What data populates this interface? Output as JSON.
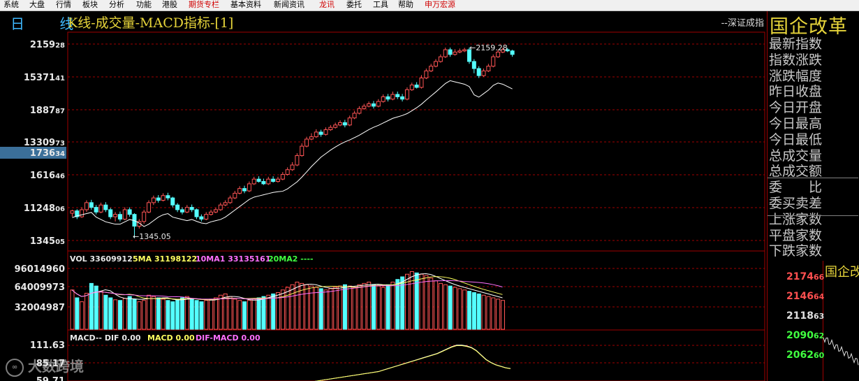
{
  "menu": [
    "系统",
    "大盘",
    "行情",
    "板块",
    "分析",
    "功能",
    "港股",
    "期货专栏",
    "基本资料",
    "新闻资讯",
    "龙讯",
    "委托",
    "工具",
    "帮助",
    "申万宏源"
  ],
  "menu_red": [
    7,
    10,
    14
  ],
  "title": {
    "period": "日 线",
    "main": "K线-成交量-MACD指标-[1]",
    "index_name": "--深证成指"
  },
  "right_panel": {
    "title": "国企改革",
    "rows": [
      "最新指数",
      "指数涨跌",
      "涨跌幅度",
      "昨日收盘",
      "今日开盘",
      "今日最高",
      "今日最低",
      "总成交量",
      "总成交额",
      "委　　比",
      "委买卖差",
      "上涨家数",
      "平盘家数",
      "下跌家数"
    ],
    "mini_title": "国企改",
    "mini_prices": [
      {
        "text": "2174",
        "sub": "66",
        "color": "#ff5050"
      },
      {
        "text": "2146",
        "sub": "64",
        "color": "#ff5050"
      },
      {
        "text": "2118",
        "sub": "63",
        "color": "#e0e0e0"
      },
      {
        "text": "2090",
        "sub": "62",
        "color": "#40ff40"
      },
      {
        "text": "2062",
        "sub": "60",
        "color": "#40ff40"
      }
    ]
  },
  "axis": {
    "price_labels": [
      {
        "big": "2159",
        "small": "28"
      },
      {
        "big": "15371",
        "small": "41"
      },
      {
        "big": "1887",
        "small": "87"
      },
      {
        "big": "13309",
        "small": "73"
      },
      {
        "big": "1736",
        "small": "34"
      },
      {
        "big": "1616",
        "small": "46"
      },
      {
        "big": "11248",
        "small": "06"
      },
      {
        "big": "1345",
        "small": "05"
      }
    ],
    "vol_labels": [
      "96014960",
      "64009973",
      "32004987"
    ],
    "macd_labels": [
      "111.63",
      "85.17",
      "59.71"
    ]
  },
  "indicators": {
    "vol": "VOL 33609912",
    "ma5": "5MA 31198122",
    "ma10": "10MA1 33135161",
    "ma20": "20MA2 ----",
    "macd": "MACD-- DIF 0.00",
    "macd_val": "MACD 0.00",
    "dif_macd": "DIF-MACD 0.00"
  },
  "annotations": {
    "high": "2159.28",
    "low": "1345.05"
  },
  "watermark": "大数跨境",
  "colors": {
    "up": "#ff5555",
    "down": "#54ffff",
    "grid": "#a00000",
    "ma5": "#ffffff",
    "ma10": "#ffff60",
    "ma20": "#ff70ff"
  },
  "chart_data": {
    "type": "candlestick",
    "price_range": [
      1345.05,
      2159.28
    ],
    "candles": [
      [
        1455,
        1465,
        1470,
        1440
      ],
      [
        1465,
        1440,
        1472,
        1430
      ],
      [
        1440,
        1470,
        1480,
        1435
      ],
      [
        1470,
        1500,
        1510,
        1460
      ],
      [
        1500,
        1480,
        1512,
        1470
      ],
      [
        1480,
        1460,
        1490,
        1450
      ],
      [
        1460,
        1490,
        1500,
        1455
      ],
      [
        1490,
        1470,
        1502,
        1460
      ],
      [
        1470,
        1440,
        1478,
        1430
      ],
      [
        1440,
        1450,
        1460,
        1420
      ],
      [
        1450,
        1430,
        1462,
        1420
      ],
      [
        1430,
        1470,
        1480,
        1425
      ],
      [
        1470,
        1450,
        1480,
        1440
      ],
      [
        1450,
        1400,
        1455,
        1350
      ],
      [
        1400,
        1420,
        1430,
        1390
      ],
      [
        1420,
        1460,
        1470,
        1410
      ],
      [
        1460,
        1500,
        1510,
        1455
      ],
      [
        1500,
        1520,
        1530,
        1490
      ],
      [
        1520,
        1510,
        1532,
        1500
      ],
      [
        1510,
        1530,
        1540,
        1505
      ],
      [
        1530,
        1520,
        1542,
        1510
      ],
      [
        1520,
        1490,
        1525,
        1480
      ],
      [
        1490,
        1470,
        1498,
        1460
      ],
      [
        1470,
        1460,
        1480,
        1450
      ],
      [
        1460,
        1480,
        1490,
        1455
      ],
      [
        1480,
        1470,
        1492,
        1460
      ],
      [
        1470,
        1440,
        1475,
        1430
      ],
      [
        1440,
        1430,
        1450,
        1420
      ],
      [
        1430,
        1450,
        1460,
        1425
      ],
      [
        1450,
        1460,
        1470,
        1445
      ],
      [
        1460,
        1470,
        1478,
        1455
      ],
      [
        1470,
        1490,
        1500,
        1465
      ],
      [
        1490,
        1500,
        1510,
        1485
      ],
      [
        1500,
        1520,
        1530,
        1495
      ],
      [
        1520,
        1540,
        1550,
        1515
      ],
      [
        1540,
        1560,
        1570,
        1535
      ],
      [
        1560,
        1550,
        1572,
        1540
      ],
      [
        1550,
        1580,
        1590,
        1545
      ],
      [
        1580,
        1600,
        1610,
        1575
      ],
      [
        1600,
        1590,
        1612,
        1585
      ],
      [
        1590,
        1580,
        1602,
        1575
      ],
      [
        1580,
        1600,
        1610,
        1575
      ],
      [
        1600,
        1590,
        1612,
        1585
      ],
      [
        1590,
        1600,
        1610,
        1585
      ],
      [
        1600,
        1620,
        1630,
        1595
      ],
      [
        1620,
        1640,
        1650,
        1615
      ],
      [
        1640,
        1660,
        1672,
        1635
      ],
      [
        1660,
        1700,
        1710,
        1655
      ],
      [
        1700,
        1740,
        1752,
        1695
      ],
      [
        1740,
        1770,
        1780,
        1735
      ],
      [
        1770,
        1780,
        1795,
        1765
      ],
      [
        1780,
        1800,
        1812,
        1775
      ],
      [
        1800,
        1790,
        1810,
        1780
      ],
      [
        1790,
        1810,
        1820,
        1785
      ],
      [
        1810,
        1820,
        1830,
        1805
      ],
      [
        1820,
        1830,
        1840,
        1815
      ],
      [
        1830,
        1840,
        1850,
        1825
      ],
      [
        1840,
        1830,
        1852,
        1820
      ],
      [
        1830,
        1860,
        1870,
        1825
      ],
      [
        1860,
        1880,
        1890,
        1855
      ],
      [
        1880,
        1900,
        1910,
        1875
      ],
      [
        1900,
        1910,
        1920,
        1895
      ],
      [
        1910,
        1920,
        1930,
        1905
      ],
      [
        1920,
        1910,
        1932,
        1900
      ],
      [
        1910,
        1930,
        1940,
        1905
      ],
      [
        1930,
        1950,
        1960,
        1925
      ],
      [
        1950,
        1940,
        1962,
        1930
      ],
      [
        1940,
        1960,
        1972,
        1935
      ],
      [
        1960,
        1950,
        1972,
        1940
      ],
      [
        1950,
        1940,
        1962,
        1930
      ],
      [
        1940,
        1980,
        1990,
        1935
      ],
      [
        1980,
        2000,
        2010,
        1975
      ],
      [
        2000,
        1990,
        2012,
        1985
      ],
      [
        1990,
        2030,
        2042,
        1985
      ],
      [
        2030,
        2060,
        2070,
        2025
      ],
      [
        2060,
        2080,
        2090,
        2055
      ],
      [
        2080,
        2100,
        2110,
        2075
      ],
      [
        2100,
        2120,
        2130,
        2095
      ],
      [
        2120,
        2150,
        2159,
        2115
      ],
      [
        2150,
        2130,
        2159,
        2120
      ],
      [
        2130,
        2140,
        2152,
        2125
      ],
      [
        2140,
        2145,
        2155,
        2135
      ],
      [
        2145,
        2150,
        2158,
        2140
      ],
      [
        2150,
        2100,
        2159,
        2090
      ],
      [
        2100,
        2070,
        2110,
        2050
      ],
      [
        2070,
        2040,
        2080,
        2030
      ],
      [
        2040,
        2060,
        2070,
        2035
      ],
      [
        2060,
        2080,
        2090,
        2055
      ],
      [
        2080,
        2120,
        2130,
        2075
      ],
      [
        2120,
        2140,
        2150,
        2115
      ],
      [
        2140,
        2150,
        2159,
        2135
      ],
      [
        2150,
        2145,
        2158,
        2140
      ],
      [
        2145,
        2130,
        2150,
        2120
      ]
    ],
    "ma_line": [
      1478,
      1485,
      1490,
      1495,
      1500,
      1480,
      1470,
      1460,
      1455,
      1450,
      1450,
      1460,
      1470,
      1465,
      1455,
      1440,
      1450,
      1465,
      1480,
      1490,
      1495,
      1480,
      1475,
      1470,
      1465,
      1470,
      1462,
      1455,
      1452,
      1460,
      1465,
      1470,
      1480,
      1495,
      1510,
      1525,
      1540,
      1555,
      1565,
      1570,
      1575,
      1580,
      1585,
      1588,
      1590,
      1600,
      1615,
      1630,
      1650,
      1672,
      1695,
      1715,
      1735,
      1750,
      1765,
      1778,
      1790,
      1800,
      1808,
      1818,
      1828,
      1840,
      1852,
      1862,
      1870,
      1880,
      1890,
      1900,
      1906,
      1912,
      1920,
      1932,
      1945,
      1960,
      1978,
      1995,
      2012,
      2030,
      2048,
      2060,
      2055,
      2050,
      2045,
      2035,
      2000,
      1990,
      2005,
      2020,
      2040,
      2050,
      2045,
      2035,
      2025
    ],
    "volume": [
      60,
      48,
      42,
      55,
      70,
      66,
      58,
      52,
      48,
      45,
      44,
      47,
      50,
      46,
      42,
      44,
      52,
      50,
      48,
      46,
      44,
      42,
      45,
      48,
      50,
      46,
      44,
      42,
      44,
      46,
      48,
      52,
      54,
      50,
      46,
      44,
      42,
      44,
      46,
      48,
      50,
      52,
      54,
      56,
      60,
      64,
      68,
      72,
      70,
      68,
      66,
      64,
      62,
      60,
      62,
      64,
      66,
      68,
      66,
      64,
      68,
      70,
      72,
      68,
      66,
      64,
      68,
      72,
      76,
      80,
      84,
      88,
      86,
      84,
      82,
      78,
      74,
      70,
      68,
      66,
      64,
      62,
      60,
      58,
      56,
      54,
      52,
      50,
      48,
      46,
      44
    ],
    "volume_max": 96014960,
    "macd_dif": [
      60,
      61,
      62,
      63,
      64,
      65,
      66,
      67,
      68,
      69,
      70,
      71,
      72,
      73,
      74,
      75,
      76,
      78,
      80,
      82,
      84,
      86,
      88,
      90,
      92,
      94,
      96,
      98,
      100,
      103,
      106,
      109,
      111,
      111,
      110,
      108,
      104,
      98,
      92,
      88,
      85,
      83,
      81,
      80
    ],
    "macd_range": [
      59.71,
      111.63
    ]
  }
}
